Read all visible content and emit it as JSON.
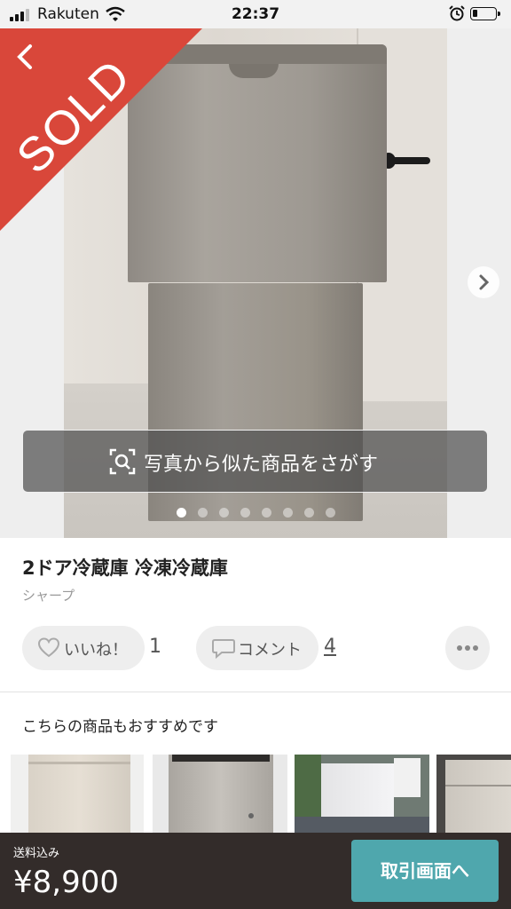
{
  "status_bar": {
    "carrier": "Rakuten",
    "time": "22:37"
  },
  "listing": {
    "sold_badge": "SOLD",
    "image_search_label": "写真から似た商品をさがす",
    "photo_count": 8,
    "current_photo": 1,
    "title": "2ドア冷蔵庫 冷凍冷蔵庫",
    "brand": "シャープ",
    "like_label": "いいね！",
    "like_count": "1",
    "comment_label": "コメント",
    "comment_count": "4"
  },
  "recommendations": {
    "title": "こちらの商品もおすすめです"
  },
  "bottom_bar": {
    "shipping_label": "送料込み",
    "price": "¥8,900",
    "action_label": "取引画面へ"
  },
  "colors": {
    "sold_red": "#d9473a",
    "action_teal": "#4fa7ad",
    "bottom_bar": "#332c2a"
  }
}
